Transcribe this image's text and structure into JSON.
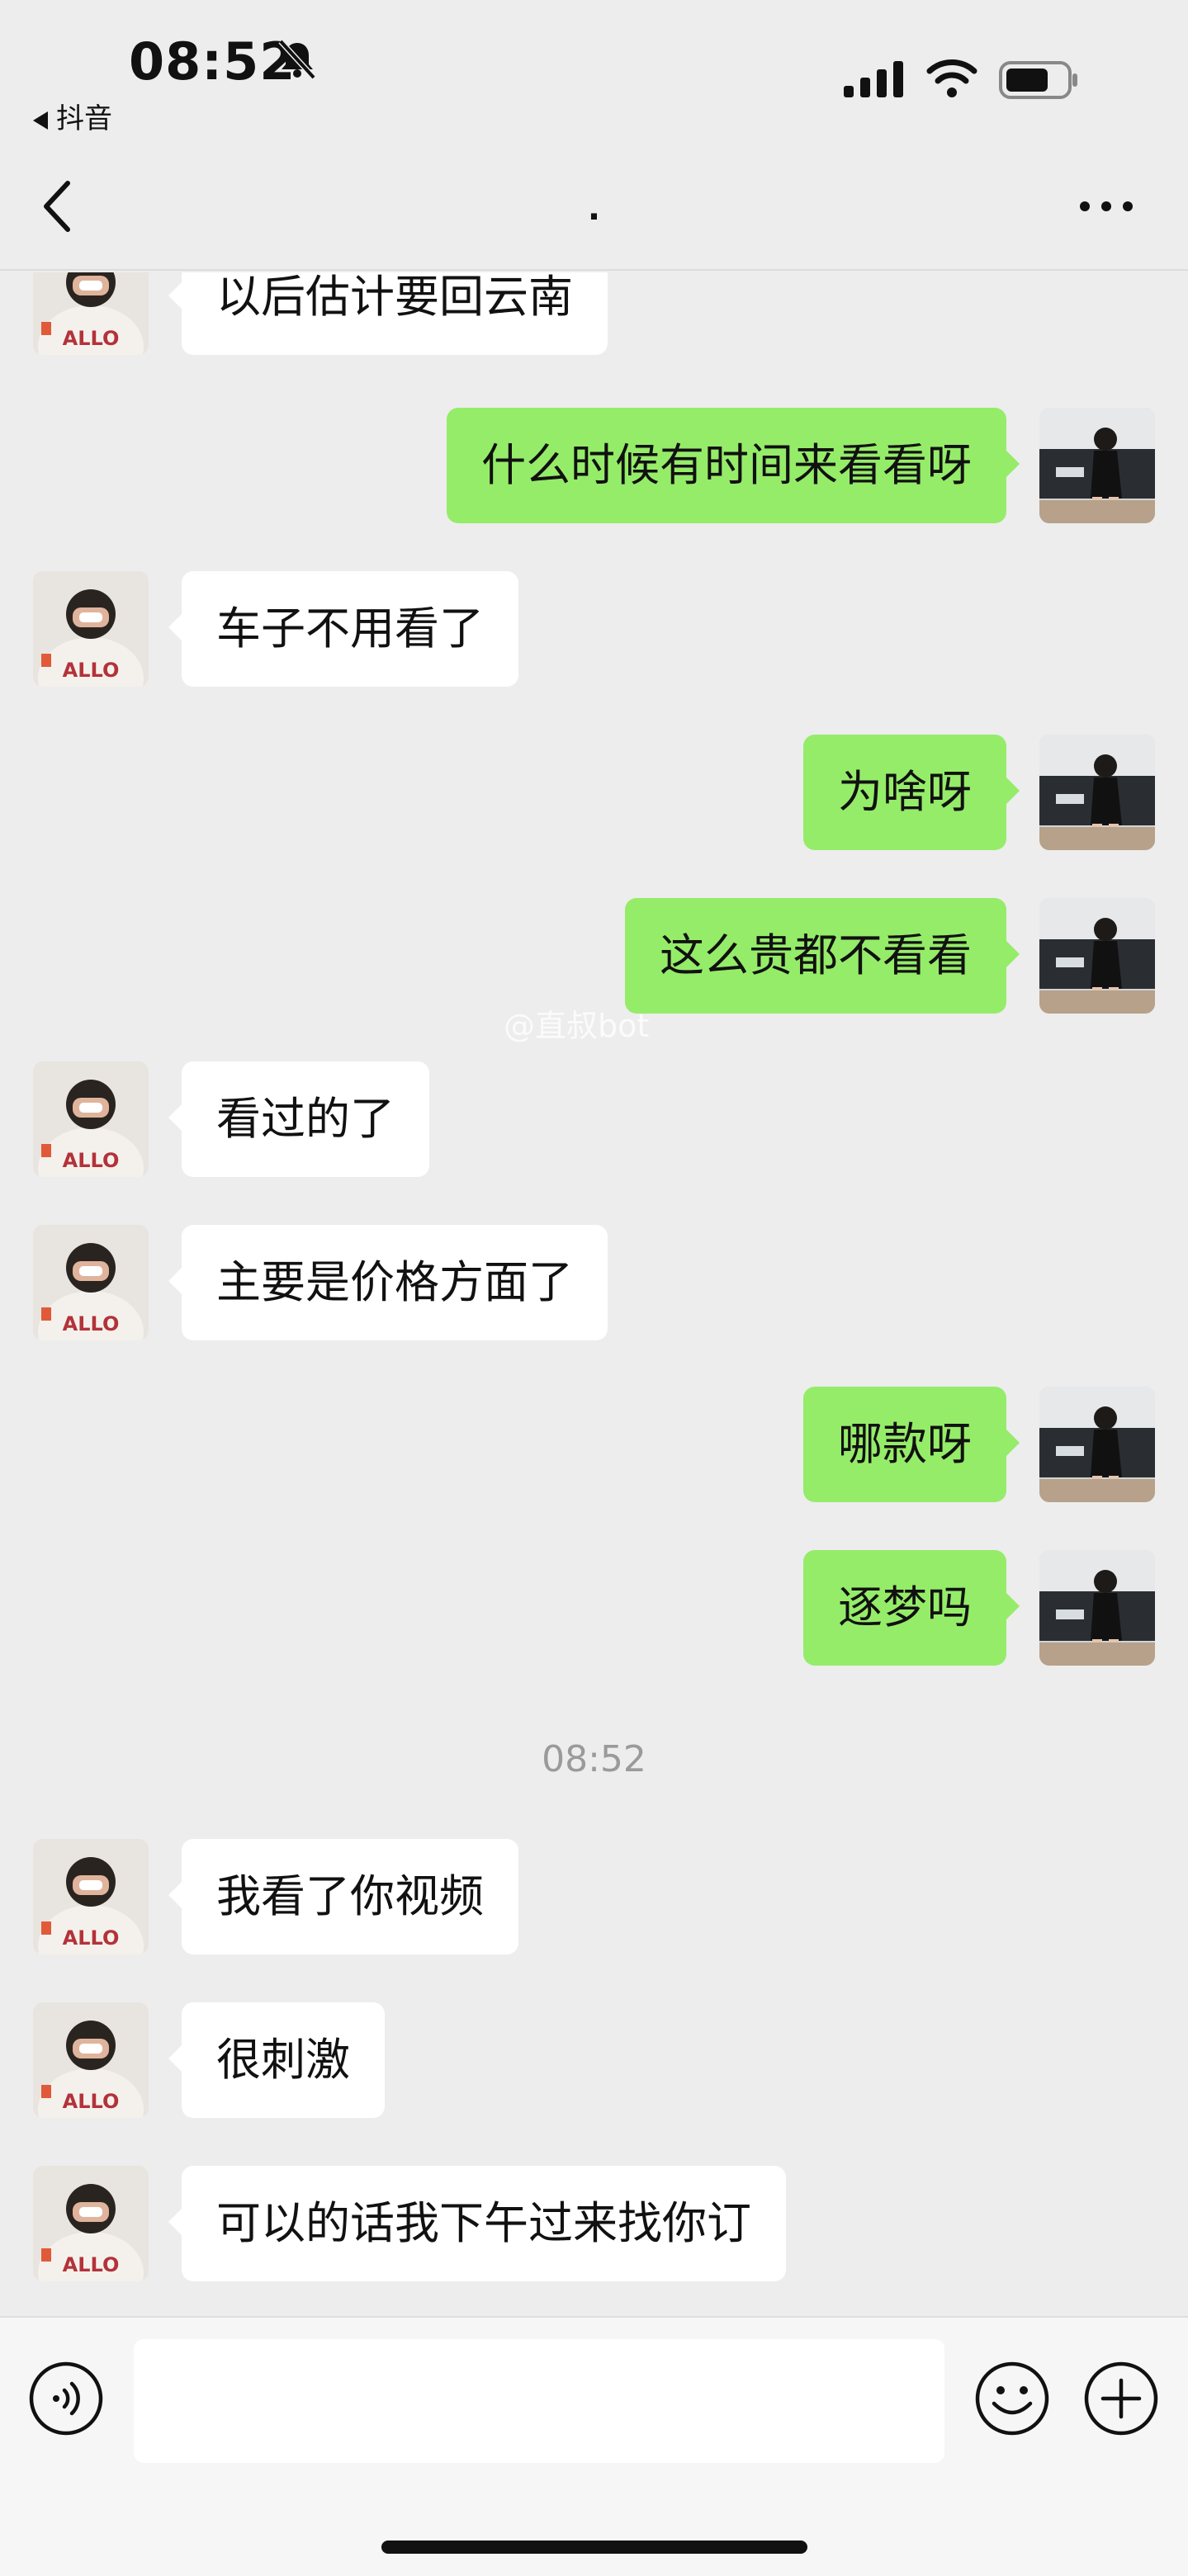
{
  "status_bar": {
    "time": "08:52",
    "back_app_label": "抖音",
    "icons": [
      "bell-off-icon",
      "signal-icon",
      "wifi-icon",
      "battery-icon"
    ]
  },
  "nav": {
    "title": ".",
    "icons": [
      "chevron-left-icon",
      "more-icon"
    ]
  },
  "messages": [
    {
      "side": "left",
      "text": "以后估计要回云南"
    },
    {
      "side": "right",
      "text": "什么时候有时间来看看呀"
    },
    {
      "side": "left",
      "text": "车子不用看了"
    },
    {
      "side": "right",
      "text": "为啥呀"
    },
    {
      "side": "right",
      "text": "这么贵都不看看"
    },
    {
      "side": "left",
      "text": "看过的了"
    },
    {
      "side": "left",
      "text": "主要是价格方面了"
    },
    {
      "side": "right",
      "text": "哪款呀"
    },
    {
      "side": "right",
      "text": "逐梦吗"
    },
    {
      "side": "left",
      "text": "我看了你视频"
    },
    {
      "side": "left",
      "text": "很刺激"
    },
    {
      "side": "left",
      "text": "可以的话我下午过来找你订"
    }
  ],
  "timestamp": "08:52",
  "watermark": "@直叔bot",
  "input_bar": {
    "placeholder": "",
    "icons": [
      "voice-icon",
      "emoji-icon",
      "plus-icon"
    ]
  },
  "colors": {
    "background": "#ededed",
    "sent_bubble": "#95ec69",
    "received_bubble": "#ffffff"
  }
}
